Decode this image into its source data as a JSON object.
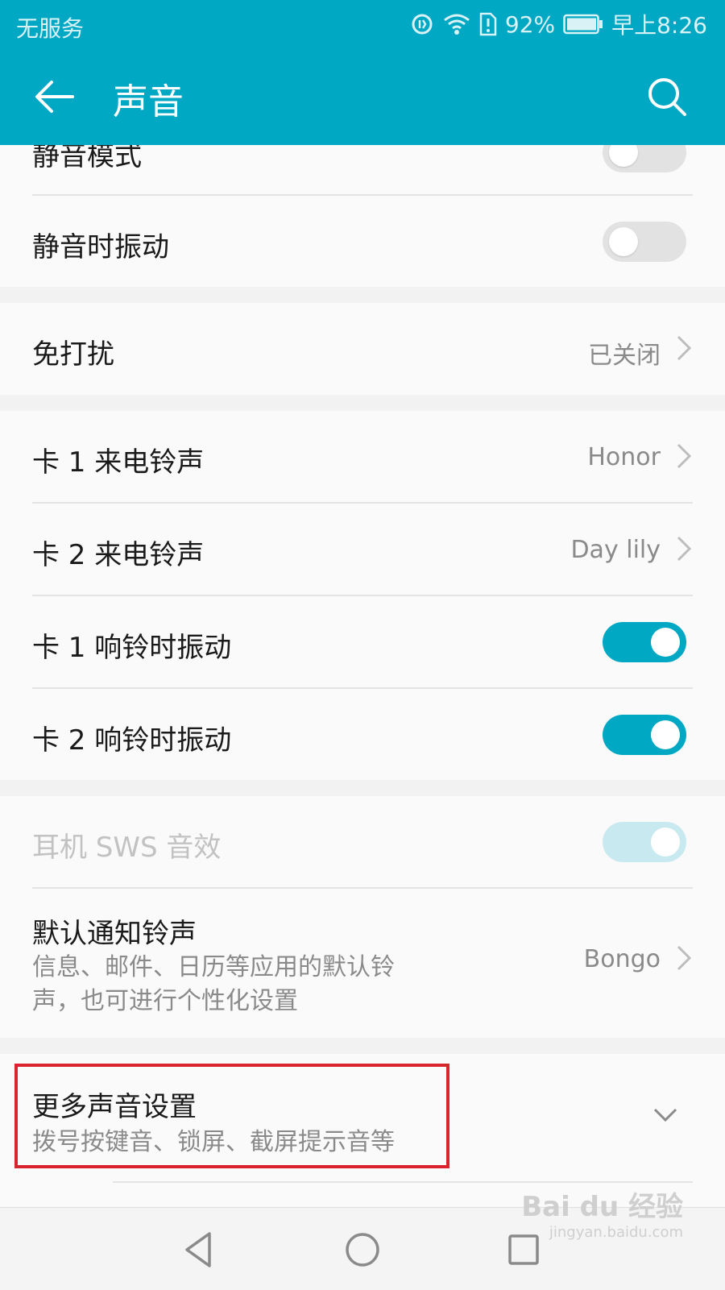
{
  "status_bar": {
    "carrier": "无服务",
    "battery_pct": "92%",
    "time": "早上8:26",
    "icons": [
      "data-saver-icon",
      "wifi-icon",
      "sim-alert-icon",
      "battery-icon"
    ]
  },
  "app_bar": {
    "title": "声音",
    "back_icon": "arrow-left-icon",
    "search_icon": "search-icon"
  },
  "colors": {
    "accent": "#00a8c4",
    "toggle_off": "#e2e2e2",
    "toggle_disabled": "#c8e9ef",
    "highlight_box": "#d9232d"
  },
  "settings": {
    "silent_mode": {
      "label": "静音模式",
      "enabled": false
    },
    "vibrate_when_silent": {
      "label": "静音时振动",
      "enabled": false
    },
    "do_not_disturb": {
      "label": "免打扰",
      "value": "已关闭"
    },
    "sim1_ringtone": {
      "label": "卡 1 来电铃声",
      "value": "Honor"
    },
    "sim2_ringtone": {
      "label": "卡 2 来电铃声",
      "value": "Day lily"
    },
    "sim1_vibrate": {
      "label": "卡 1 响铃时振动",
      "enabled": true
    },
    "sim2_vibrate": {
      "label": "卡 2 响铃时振动",
      "enabled": true
    },
    "headset_sws": {
      "label": "耳机 SWS 音效",
      "enabled": true,
      "disabled": true
    },
    "default_notification": {
      "label": "默认通知铃声",
      "subtitle_line1": "信息、邮件、日历等应用的默认铃",
      "subtitle_line2": "声，也可进行个性化设置",
      "value": "Bongo"
    },
    "more_sound": {
      "label": "更多声音设置",
      "subtitle": "拨号按键音、锁屏、截屏提示音等"
    }
  },
  "nav_bar": {
    "icons": [
      "nav-back-triangle-icon",
      "nav-home-circle-icon",
      "nav-recents-square-icon"
    ]
  },
  "watermark": {
    "text": "Bai du 经验",
    "sub": "jingyan.baidu.com"
  }
}
